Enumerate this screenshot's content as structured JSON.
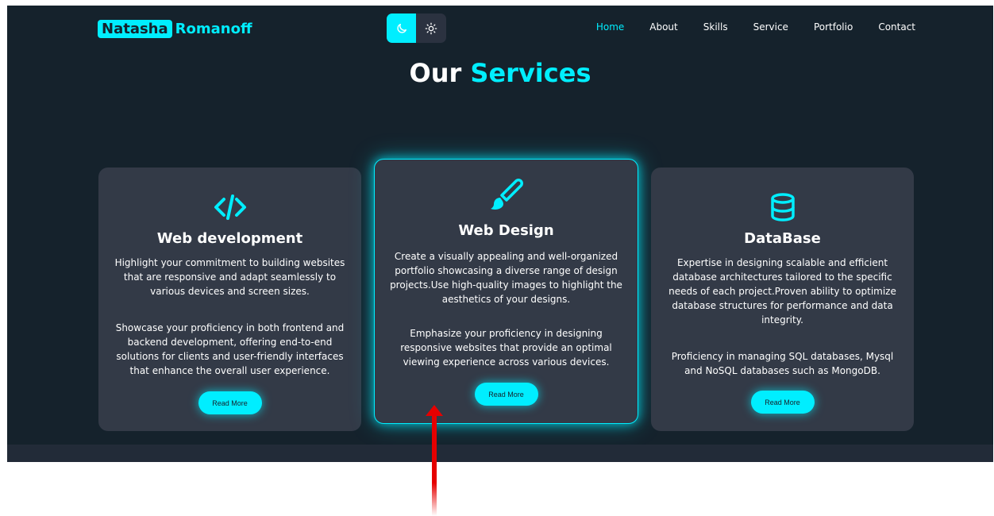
{
  "header": {
    "logo_first": "Natasha",
    "logo_last": "Romanoff",
    "theme_toggle": {
      "dark_icon": "moon-icon",
      "light_icon": "sun-icon",
      "active": "dark"
    },
    "nav": [
      "Home",
      "About",
      "Skills",
      "Service",
      "Portfolio",
      "Contact"
    ],
    "active_nav": "Home"
  },
  "section": {
    "title_main": "Our",
    "title_accent": "Services"
  },
  "cards": [
    {
      "icon": "code-icon",
      "title": "Web development",
      "paragraph1": "Highlight your commitment to building websites that are responsive and adapt seamlessly to various devices and screen sizes.",
      "paragraph2": "Showcase your proficiency in both frontend and backend development, offering end-to-end solutions for clients and user-friendly interfaces that enhance the overall user experience.",
      "button": "Read More"
    },
    {
      "icon": "paintbrush-icon",
      "title": "Web Design",
      "paragraph1": "Create a visually appealing and well-organized portfolio showcasing a diverse range of design projects.Use high-quality images to highlight the aesthetics of your designs.",
      "paragraph2": "Emphasize your proficiency in designing responsive websites that provide an optimal viewing experience across various devices.",
      "button": "Read More",
      "highlighted": true
    },
    {
      "icon": "database-icon",
      "title": "DataBase",
      "paragraph1": "Expertise in designing scalable and efficient database architectures tailored to the specific needs of each project.Proven ability to optimize database structures for performance and data integrity.",
      "paragraph2": "Proficiency in managing SQL databases, Mysql and NoSQL databases such as MongoDB.",
      "button": "Read More"
    }
  ],
  "colors": {
    "accent": "#00eeff",
    "background": "#15222c",
    "card": "#333a47",
    "text": "#ffffff",
    "cursor": "#e60000"
  }
}
